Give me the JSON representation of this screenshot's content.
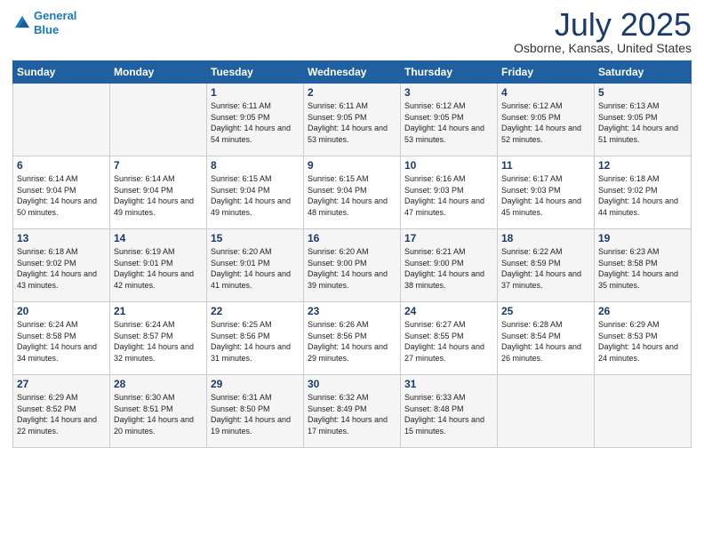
{
  "header": {
    "logo_line1": "General",
    "logo_line2": "Blue",
    "month": "July 2025",
    "location": "Osborne, Kansas, United States"
  },
  "weekdays": [
    "Sunday",
    "Monday",
    "Tuesday",
    "Wednesday",
    "Thursday",
    "Friday",
    "Saturday"
  ],
  "weeks": [
    [
      {
        "day": "",
        "sunrise": "",
        "sunset": "",
        "daylight": ""
      },
      {
        "day": "",
        "sunrise": "",
        "sunset": "",
        "daylight": ""
      },
      {
        "day": "1",
        "sunrise": "Sunrise: 6:11 AM",
        "sunset": "Sunset: 9:05 PM",
        "daylight": "Daylight: 14 hours and 54 minutes."
      },
      {
        "day": "2",
        "sunrise": "Sunrise: 6:11 AM",
        "sunset": "Sunset: 9:05 PM",
        "daylight": "Daylight: 14 hours and 53 minutes."
      },
      {
        "day": "3",
        "sunrise": "Sunrise: 6:12 AM",
        "sunset": "Sunset: 9:05 PM",
        "daylight": "Daylight: 14 hours and 53 minutes."
      },
      {
        "day": "4",
        "sunrise": "Sunrise: 6:12 AM",
        "sunset": "Sunset: 9:05 PM",
        "daylight": "Daylight: 14 hours and 52 minutes."
      },
      {
        "day": "5",
        "sunrise": "Sunrise: 6:13 AM",
        "sunset": "Sunset: 9:05 PM",
        "daylight": "Daylight: 14 hours and 51 minutes."
      }
    ],
    [
      {
        "day": "6",
        "sunrise": "Sunrise: 6:14 AM",
        "sunset": "Sunset: 9:04 PM",
        "daylight": "Daylight: 14 hours and 50 minutes."
      },
      {
        "day": "7",
        "sunrise": "Sunrise: 6:14 AM",
        "sunset": "Sunset: 9:04 PM",
        "daylight": "Daylight: 14 hours and 49 minutes."
      },
      {
        "day": "8",
        "sunrise": "Sunrise: 6:15 AM",
        "sunset": "Sunset: 9:04 PM",
        "daylight": "Daylight: 14 hours and 49 minutes."
      },
      {
        "day": "9",
        "sunrise": "Sunrise: 6:15 AM",
        "sunset": "Sunset: 9:04 PM",
        "daylight": "Daylight: 14 hours and 48 minutes."
      },
      {
        "day": "10",
        "sunrise": "Sunrise: 6:16 AM",
        "sunset": "Sunset: 9:03 PM",
        "daylight": "Daylight: 14 hours and 47 minutes."
      },
      {
        "day": "11",
        "sunrise": "Sunrise: 6:17 AM",
        "sunset": "Sunset: 9:03 PM",
        "daylight": "Daylight: 14 hours and 45 minutes."
      },
      {
        "day": "12",
        "sunrise": "Sunrise: 6:18 AM",
        "sunset": "Sunset: 9:02 PM",
        "daylight": "Daylight: 14 hours and 44 minutes."
      }
    ],
    [
      {
        "day": "13",
        "sunrise": "Sunrise: 6:18 AM",
        "sunset": "Sunset: 9:02 PM",
        "daylight": "Daylight: 14 hours and 43 minutes."
      },
      {
        "day": "14",
        "sunrise": "Sunrise: 6:19 AM",
        "sunset": "Sunset: 9:01 PM",
        "daylight": "Daylight: 14 hours and 42 minutes."
      },
      {
        "day": "15",
        "sunrise": "Sunrise: 6:20 AM",
        "sunset": "Sunset: 9:01 PM",
        "daylight": "Daylight: 14 hours and 41 minutes."
      },
      {
        "day": "16",
        "sunrise": "Sunrise: 6:20 AM",
        "sunset": "Sunset: 9:00 PM",
        "daylight": "Daylight: 14 hours and 39 minutes."
      },
      {
        "day": "17",
        "sunrise": "Sunrise: 6:21 AM",
        "sunset": "Sunset: 9:00 PM",
        "daylight": "Daylight: 14 hours and 38 minutes."
      },
      {
        "day": "18",
        "sunrise": "Sunrise: 6:22 AM",
        "sunset": "Sunset: 8:59 PM",
        "daylight": "Daylight: 14 hours and 37 minutes."
      },
      {
        "day": "19",
        "sunrise": "Sunrise: 6:23 AM",
        "sunset": "Sunset: 8:58 PM",
        "daylight": "Daylight: 14 hours and 35 minutes."
      }
    ],
    [
      {
        "day": "20",
        "sunrise": "Sunrise: 6:24 AM",
        "sunset": "Sunset: 8:58 PM",
        "daylight": "Daylight: 14 hours and 34 minutes."
      },
      {
        "day": "21",
        "sunrise": "Sunrise: 6:24 AM",
        "sunset": "Sunset: 8:57 PM",
        "daylight": "Daylight: 14 hours and 32 minutes."
      },
      {
        "day": "22",
        "sunrise": "Sunrise: 6:25 AM",
        "sunset": "Sunset: 8:56 PM",
        "daylight": "Daylight: 14 hours and 31 minutes."
      },
      {
        "day": "23",
        "sunrise": "Sunrise: 6:26 AM",
        "sunset": "Sunset: 8:56 PM",
        "daylight": "Daylight: 14 hours and 29 minutes."
      },
      {
        "day": "24",
        "sunrise": "Sunrise: 6:27 AM",
        "sunset": "Sunset: 8:55 PM",
        "daylight": "Daylight: 14 hours and 27 minutes."
      },
      {
        "day": "25",
        "sunrise": "Sunrise: 6:28 AM",
        "sunset": "Sunset: 8:54 PM",
        "daylight": "Daylight: 14 hours and 26 minutes."
      },
      {
        "day": "26",
        "sunrise": "Sunrise: 6:29 AM",
        "sunset": "Sunset: 8:53 PM",
        "daylight": "Daylight: 14 hours and 24 minutes."
      }
    ],
    [
      {
        "day": "27",
        "sunrise": "Sunrise: 6:29 AM",
        "sunset": "Sunset: 8:52 PM",
        "daylight": "Daylight: 14 hours and 22 minutes."
      },
      {
        "day": "28",
        "sunrise": "Sunrise: 6:30 AM",
        "sunset": "Sunset: 8:51 PM",
        "daylight": "Daylight: 14 hours and 20 minutes."
      },
      {
        "day": "29",
        "sunrise": "Sunrise: 6:31 AM",
        "sunset": "Sunset: 8:50 PM",
        "daylight": "Daylight: 14 hours and 19 minutes."
      },
      {
        "day": "30",
        "sunrise": "Sunrise: 6:32 AM",
        "sunset": "Sunset: 8:49 PM",
        "daylight": "Daylight: 14 hours and 17 minutes."
      },
      {
        "day": "31",
        "sunrise": "Sunrise: 6:33 AM",
        "sunset": "Sunset: 8:48 PM",
        "daylight": "Daylight: 14 hours and 15 minutes."
      },
      {
        "day": "",
        "sunrise": "",
        "sunset": "",
        "daylight": ""
      },
      {
        "day": "",
        "sunrise": "",
        "sunset": "",
        "daylight": ""
      }
    ]
  ]
}
